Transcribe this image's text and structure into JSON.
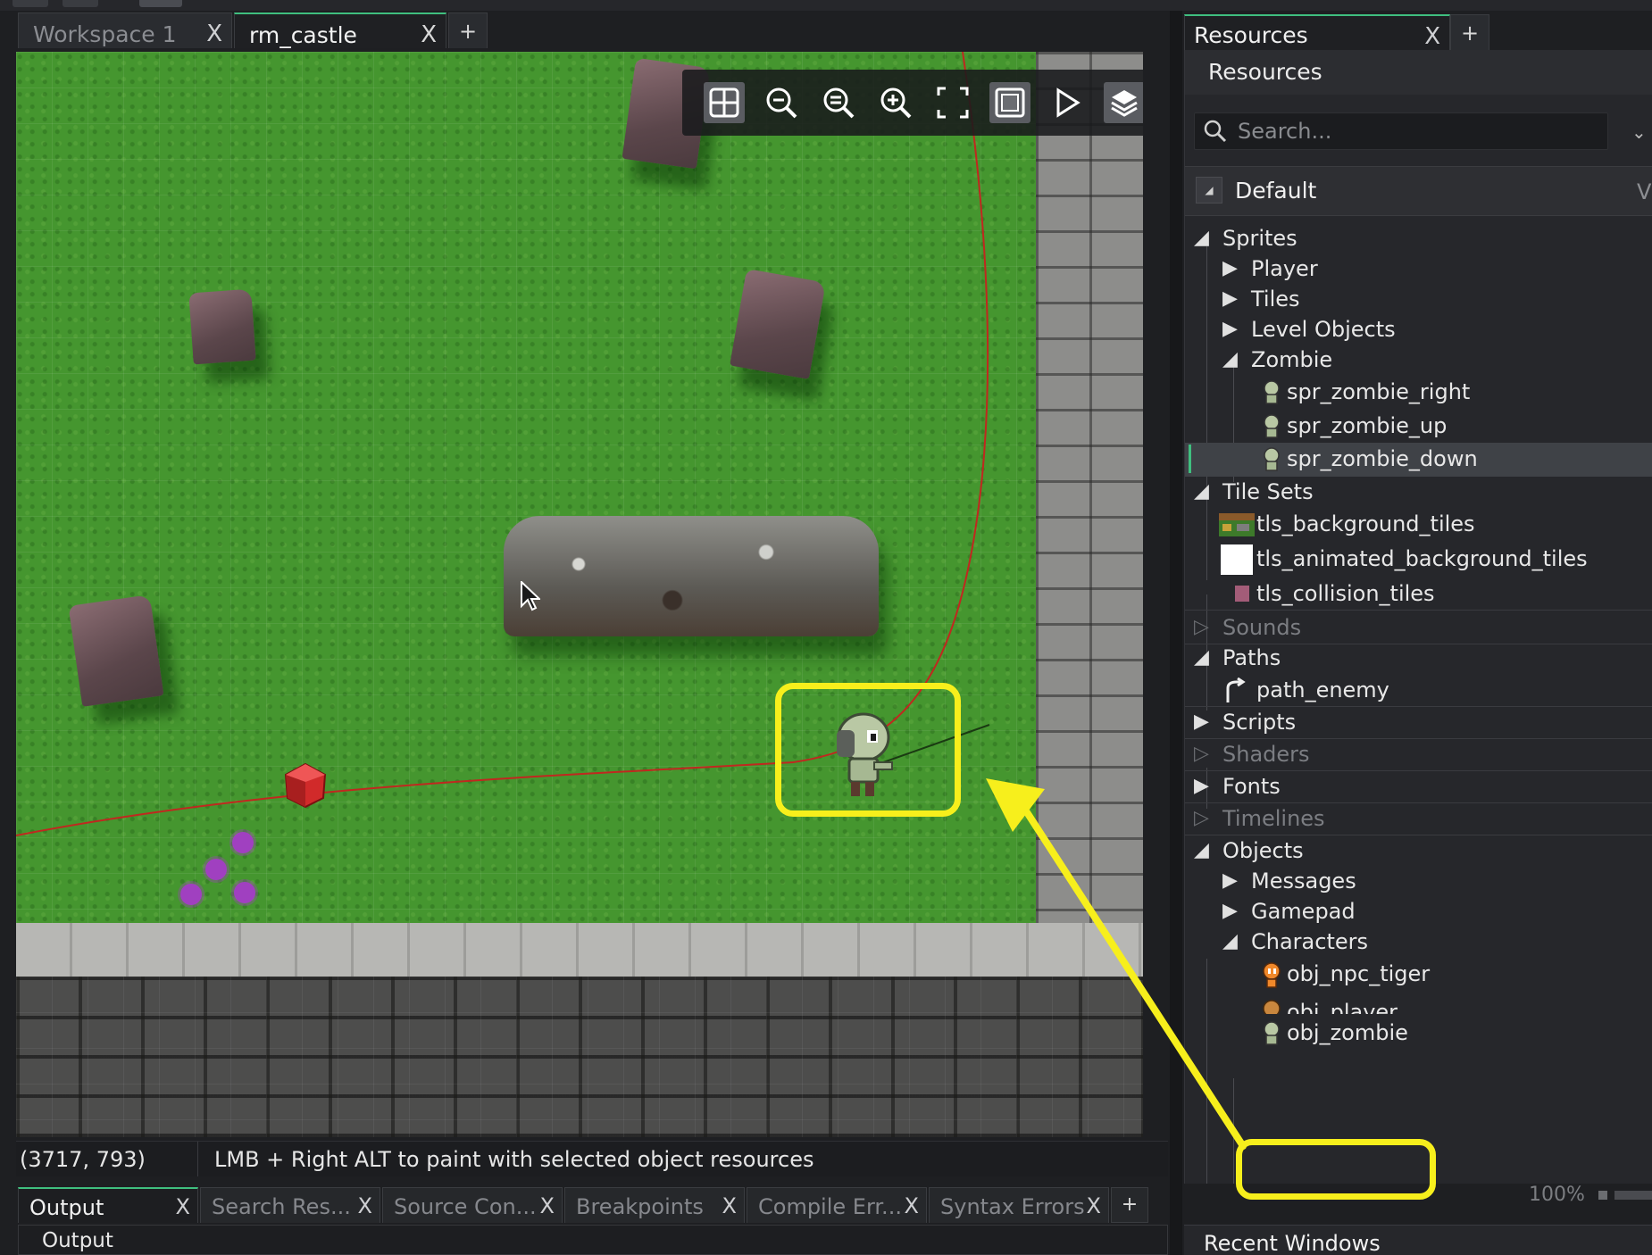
{
  "workspace_tabs": [
    {
      "label": "Workspace 1",
      "active": false
    },
    {
      "label": "rm_castle",
      "active": true
    }
  ],
  "add_tab_label": "+",
  "close_glyph": "X",
  "room_toolbar": {
    "icons": [
      "grid-toggle-icon",
      "zoom-out-icon",
      "zoom-reset-icon",
      "zoom-in-icon",
      "fullscreen-icon",
      "frame-icon",
      "play-icon",
      "layers-icon"
    ]
  },
  "status_bar": {
    "coordinates": "(3717, 793)",
    "hint": "LMB + Right ALT to paint with selected object resources"
  },
  "output_tabs": [
    {
      "label": "Output",
      "active": true
    },
    {
      "label": "Search Res...",
      "active": false
    },
    {
      "label": "Source Con...",
      "active": false
    },
    {
      "label": "Breakpoints",
      "active": false
    },
    {
      "label": "Compile Err...",
      "active": false
    },
    {
      "label": "Syntax Errors",
      "active": false
    }
  ],
  "output_panel_title": "Output",
  "resources": {
    "tab_label": "Resources",
    "title": "Resources",
    "search_placeholder": "Search...",
    "group": "Default",
    "group_extra": "Vi",
    "tree": {
      "sprites": "Sprites",
      "player": "Player",
      "tiles": "Tiles",
      "level_objects": "Level Objects",
      "zombie": "Zombie",
      "spr_zombie_right": "spr_zombie_right",
      "spr_zombie_up": "spr_zombie_up",
      "spr_zombie_down": "spr_zombie_down",
      "tile_sets": "Tile Sets",
      "tls_background_tiles": "tls_background_tiles",
      "tls_animated_background_tiles": "tls_animated_background_tiles",
      "tls_collision_tiles": "tls_collision_tiles",
      "sounds": "Sounds",
      "paths": "Paths",
      "path_enemy": "path_enemy",
      "scripts": "Scripts",
      "shaders": "Shaders",
      "fonts": "Fonts",
      "timelines": "Timelines",
      "objects": "Objects",
      "messages": "Messages",
      "gamepad": "Gamepad",
      "characters": "Characters",
      "obj_npc_tiger": "obj_npc_tiger",
      "obj_player": "obj_player",
      "obj_zombie": "obj_zombie"
    },
    "zoom": "100%",
    "recent_windows": "Recent Windows"
  },
  "colors": {
    "accent": "#3fbf7f",
    "highlight": "#f7ef1c",
    "path_line": "#c0281f"
  }
}
